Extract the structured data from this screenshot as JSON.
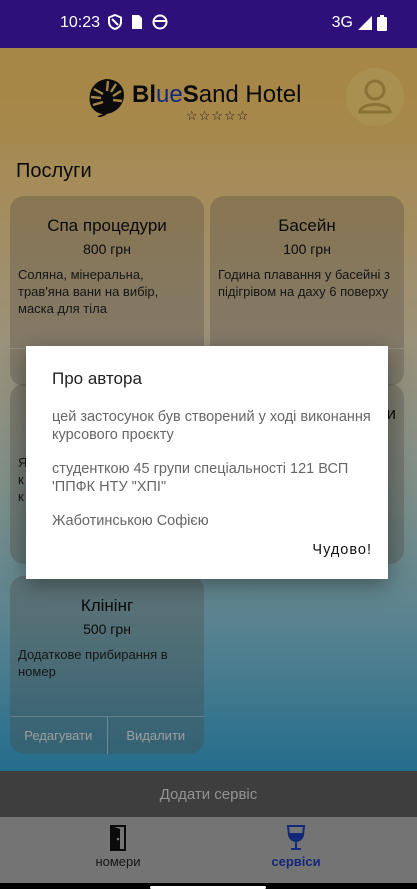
{
  "status_bar": {
    "time": "10:23",
    "network": "3G",
    "icons": [
      "shield-icon",
      "sim-card-icon",
      "face-icon",
      "signal-icon",
      "battery-icon"
    ]
  },
  "header": {
    "brand_bold": "Bl",
    "brand_accent": "ue",
    "brand_bold2": "S",
    "brand_rest": "and Hotel",
    "stars": "☆☆☆☆☆"
  },
  "page": {
    "title": "Послуги"
  },
  "services": [
    {
      "title": "Спа процедури",
      "price": "800 грн",
      "description": "Соляна, мінеральна, трав'яна вани на вибір, маска для тіла"
    },
    {
      "title": "Басейн",
      "price": "100 грн",
      "description": "Година плавання у басейні з підігрівом на даху 6 поверху"
    },
    {
      "title": "Клінінг",
      "price": "500 грн",
      "description": "Додаткове прибирання в номер",
      "edit_label": "Редагувати",
      "delete_label": "Видалити"
    }
  ],
  "hidden_card_fragments": {
    "left_letters": [
      "Я",
      "к",
      "к"
    ],
    "right_letter": "и"
  },
  "add_button": {
    "label": "Додати сервіс"
  },
  "bottom_nav": [
    {
      "label": "номери",
      "icon": "door-icon"
    },
    {
      "label": "сервіси",
      "icon": "wine-glass-icon"
    }
  ],
  "dialog": {
    "title": "Про автора",
    "line1": "цей застосунок був створений у ході виконання курсового проєкту",
    "line2": "студенткою 45 групи спеціальності 121 ВСП 'ППФК НТУ \"ХПІ\"",
    "line3": "Жаботинською Софією",
    "ok_label": "Чудово!"
  },
  "colors": {
    "status_bar": "#2d107a",
    "accent_blue": "#1b3db3",
    "nav_active": "#1b3db3"
  }
}
